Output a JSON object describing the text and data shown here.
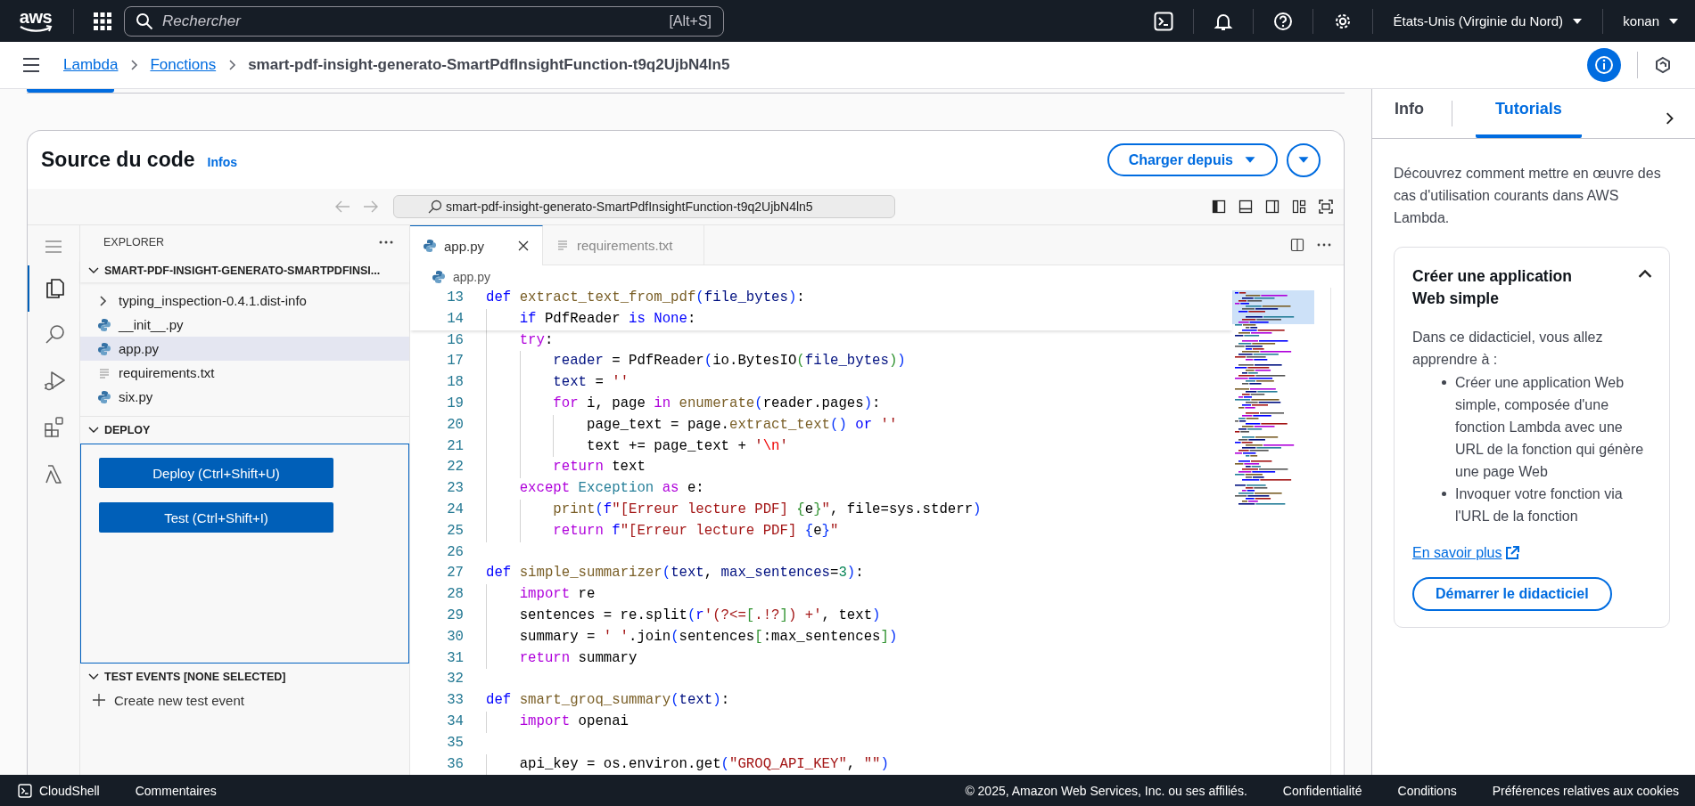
{
  "top_bar": {
    "logo": "aws",
    "search": {
      "placeholder": "Rechercher",
      "shortcut": "[Alt+S]"
    },
    "region": "États-Unis (Virginie du Nord)",
    "user": "konan"
  },
  "breadcrumb": [
    {
      "label": "Lambda",
      "kind": "link"
    },
    {
      "label": "Fonctions",
      "kind": "link"
    },
    {
      "label": "smart-pdf-insight-generato-SmartPdfInsightFunction-t9q2UjbN4ln5",
      "kind": "current"
    }
  ],
  "code_source": {
    "title": "Source du code",
    "info_link": "Infos",
    "load_button": "Charger depuis"
  },
  "ide": {
    "address": "smart-pdf-insight-generato-SmartPdfInsightFunction-t9q2UjbN4ln5",
    "activity_bar": [
      {
        "kind": "explorer",
        "selected": true
      },
      {
        "kind": "search",
        "selected": false
      },
      {
        "kind": "debug",
        "selected": false
      },
      {
        "kind": "extensions",
        "selected": false
      },
      {
        "kind": "lambda",
        "selected": false
      }
    ],
    "explorer": {
      "title": "EXPLORER",
      "sections": [
        {
          "kind": "files",
          "title": "SMART-PDF-INSIGHT-GENERATO-SMARTPDFINSI...",
          "expanded": true,
          "items": [
            {
              "kind": "folder",
              "label": "typing_inspection-0.4.1.dist-info",
              "expanded": false,
              "selected": false
            },
            {
              "kind": "python",
              "label": "__init__.py",
              "selected": false
            },
            {
              "kind": "python",
              "label": "app.py",
              "selected": true
            },
            {
              "kind": "text",
              "label": "requirements.txt",
              "selected": false
            },
            {
              "kind": "python",
              "label": "six.py",
              "selected": false
            }
          ]
        },
        {
          "kind": "deploy",
          "title": "DEPLOY",
          "expanded": true,
          "buttons": [
            "Deploy (Ctrl+Shift+U)",
            "Test (Ctrl+Shift+I)"
          ]
        },
        {
          "kind": "test_events",
          "title": "TEST EVENTS [NONE SELECTED]",
          "expanded": true,
          "action": "Create new test event"
        }
      ]
    },
    "tabs": [
      {
        "label": "app.py",
        "kind": "python",
        "selected": true
      },
      {
        "label": "requirements.txt",
        "kind": "text",
        "selected": false
      }
    ],
    "file_breadcrumb": "app.py",
    "code": {
      "sticky": [
        {
          "number": "13",
          "tokens": [
            {
              "kind": "kw",
              "text": "def"
            },
            {
              "kind": "fn",
              "text": " extract_text_from_pdf"
            },
            {
              "kind": "b1",
              "text": "("
            },
            {
              "kind": "var",
              "text": "file_bytes"
            },
            {
              "kind": "b1",
              "text": ")"
            },
            {
              "kind": "p",
              "text": ":"
            }
          ]
        },
        {
          "number": "14",
          "tokens": [
            {
              "kind": "kw",
              "text": "    if"
            },
            {
              "kind": "p",
              "text": " PdfReader "
            },
            {
              "kind": "kw",
              "text": "is"
            },
            {
              "kind": "kw",
              "text": " None"
            },
            {
              "kind": "p",
              "text": ":"
            }
          ]
        }
      ],
      "lines": [
        {
          "number": "16",
          "tokens": [
            {
              "kind": "ctrl",
              "text": "    try"
            },
            {
              "kind": "p",
              "text": ":"
            }
          ]
        },
        {
          "number": "17",
          "tokens": [
            {
              "kind": "var",
              "text": "        reader"
            },
            {
              "kind": "p",
              "text": " = PdfReader"
            },
            {
              "kind": "b1",
              "text": "("
            },
            {
              "kind": "p",
              "text": "io.BytesIO"
            },
            {
              "kind": "b2",
              "text": "("
            },
            {
              "kind": "var",
              "text": "file_bytes"
            },
            {
              "kind": "b2",
              "text": ")"
            },
            {
              "kind": "b1",
              "text": ")"
            }
          ]
        },
        {
          "number": "18",
          "tokens": [
            {
              "kind": "var",
              "text": "        text"
            },
            {
              "kind": "p",
              "text": " = "
            },
            {
              "kind": "str",
              "text": "''"
            }
          ]
        },
        {
          "number": "19",
          "tokens": [
            {
              "kind": "ctrl",
              "text": "        for"
            },
            {
              "kind": "p",
              "text": " i, page "
            },
            {
              "kind": "ctrl",
              "text": "in"
            },
            {
              "kind": "fn",
              "text": " enumerate"
            },
            {
              "kind": "b1",
              "text": "("
            },
            {
              "kind": "p",
              "text": "reader.pages"
            },
            {
              "kind": "b1",
              "text": ")"
            },
            {
              "kind": "p",
              "text": ":"
            }
          ]
        },
        {
          "number": "20",
          "tokens": [
            {
              "kind": "p",
              "text": "            page_text = page."
            },
            {
              "kind": "fn",
              "text": "extract_text"
            },
            {
              "kind": "b1",
              "text": "()"
            },
            {
              "kind": "kw",
              "text": " or"
            },
            {
              "kind": "str",
              "text": " ''"
            }
          ]
        },
        {
          "number": "21",
          "tokens": [
            {
              "kind": "p",
              "text": "            text += page_text + "
            },
            {
              "kind": "str",
              "text": "'"
            },
            {
              "kind": "esc",
              "text": "\\n"
            },
            {
              "kind": "str",
              "text": "'"
            }
          ]
        },
        {
          "number": "22",
          "tokens": [
            {
              "kind": "ctrl",
              "text": "        return"
            },
            {
              "kind": "p",
              "text": " text"
            }
          ]
        },
        {
          "number": "23",
          "tokens": [
            {
              "kind": "ctrl",
              "text": "    except"
            },
            {
              "kind": "cls",
              "text": " Exception"
            },
            {
              "kind": "ctrl",
              "text": " as"
            },
            {
              "kind": "p",
              "text": " e:"
            }
          ]
        },
        {
          "number": "24",
          "tokens": [
            {
              "kind": "fn",
              "text": "        print"
            },
            {
              "kind": "b1",
              "text": "("
            },
            {
              "kind": "kw",
              "text": "f"
            },
            {
              "kind": "str",
              "text": "\"[Erreur lecture PDF] "
            },
            {
              "kind": "b2",
              "text": "{"
            },
            {
              "kind": "p",
              "text": "e"
            },
            {
              "kind": "b2",
              "text": "}"
            },
            {
              "kind": "str",
              "text": "\""
            },
            {
              "kind": "p",
              "text": ", file=sys.stderr"
            },
            {
              "kind": "b1",
              "text": ")"
            }
          ]
        },
        {
          "number": "25",
          "tokens": [
            {
              "kind": "ctrl",
              "text": "        return"
            },
            {
              "kind": "kw",
              "text": " f"
            },
            {
              "kind": "str",
              "text": "\"[Erreur lecture PDF] "
            },
            {
              "kind": "b1",
              "text": "{"
            },
            {
              "kind": "p",
              "text": "e"
            },
            {
              "kind": "b1",
              "text": "}"
            },
            {
              "kind": "str",
              "text": "\""
            }
          ]
        },
        {
          "number": "26"
        },
        {
          "number": "27",
          "tokens": [
            {
              "kind": "kw",
              "text": "def"
            },
            {
              "kind": "fn",
              "text": " simple_summarizer"
            },
            {
              "kind": "b1",
              "text": "("
            },
            {
              "kind": "var",
              "text": "text"
            },
            {
              "kind": "p",
              "text": ", "
            },
            {
              "kind": "var",
              "text": "max_sentences"
            },
            {
              "kind": "p",
              "text": "="
            },
            {
              "kind": "num",
              "text": "3"
            },
            {
              "kind": "b1",
              "text": ")"
            },
            {
              "kind": "p",
              "text": ":"
            }
          ]
        },
        {
          "number": "28",
          "tokens": [
            {
              "kind": "ctrl",
              "text": "    import"
            },
            {
              "kind": "p",
              "text": " re"
            }
          ]
        },
        {
          "number": "29",
          "tokens": [
            {
              "kind": "p",
              "text": "    sentences = re.split"
            },
            {
              "kind": "b1",
              "text": "("
            },
            {
              "kind": "kw",
              "text": "r"
            },
            {
              "kind": "str",
              "text": "'(?<="
            },
            {
              "kind": "b2",
              "text": "["
            },
            {
              "kind": "str",
              "text": ".!?"
            },
            {
              "kind": "b2",
              "text": "]"
            },
            {
              "kind": "str",
              "text": ") +'"
            },
            {
              "kind": "p",
              "text": ", text"
            },
            {
              "kind": "b1",
              "text": ")"
            }
          ]
        },
        {
          "number": "30",
          "tokens": [
            {
              "kind": "p",
              "text": "    summary = "
            },
            {
              "kind": "str",
              "text": "' '"
            },
            {
              "kind": "p",
              "text": ".join"
            },
            {
              "kind": "b1",
              "text": "("
            },
            {
              "kind": "p",
              "text": "sentences"
            },
            {
              "kind": "b2",
              "text": "["
            },
            {
              "kind": "p",
              "text": ":max_sentences"
            },
            {
              "kind": "b2",
              "text": "]"
            },
            {
              "kind": "b1",
              "text": ")"
            }
          ]
        },
        {
          "number": "31",
          "tokens": [
            {
              "kind": "ctrl",
              "text": "    return"
            },
            {
              "kind": "p",
              "text": " summary"
            }
          ]
        },
        {
          "number": "32"
        },
        {
          "number": "33",
          "tokens": [
            {
              "kind": "kw",
              "text": "def"
            },
            {
              "kind": "fn",
              "text": " smart_groq_summary"
            },
            {
              "kind": "b1",
              "text": "("
            },
            {
              "kind": "var",
              "text": "text"
            },
            {
              "kind": "b1",
              "text": ")"
            },
            {
              "kind": "p",
              "text": ":"
            }
          ]
        },
        {
          "number": "34",
          "tokens": [
            {
              "kind": "ctrl",
              "text": "    import"
            },
            {
              "kind": "p",
              "text": " openai"
            }
          ]
        },
        {
          "number": "35"
        },
        {
          "number": "36",
          "tokens": [
            {
              "kind": "p",
              "text": "    api_key = os.environ.get"
            },
            {
              "kind": "b1",
              "text": "("
            },
            {
              "kind": "str",
              "text": "\"GROQ_API_KEY\""
            },
            {
              "kind": "p",
              "text": ", "
            },
            {
              "kind": "str",
              "text": "\"\""
            },
            {
              "kind": "b1",
              "text": ")"
            }
          ]
        }
      ]
    }
  },
  "side_panel": {
    "tabs": [
      {
        "label": "Info",
        "selected": false
      },
      {
        "label": "Tutorials",
        "selected": true
      }
    ],
    "intro": "Découvrez comment mettre en œuvre des cas d'utilisation courants dans AWS Lambda.",
    "tutorial": {
      "title": "Créer une application Web simple",
      "expanded": true,
      "lead": "Dans ce didacticiel, vous allez apprendre à :",
      "bullets": [
        "Créer une application Web simple, composée d'une fonction Lambda avec une URL de la fonction qui génère une page Web",
        "Invoquer votre fonction via l'URL de la fonction"
      ],
      "link": "En savoir plus",
      "button": "Démarrer le didacticiel"
    }
  },
  "footer": {
    "cloudshell": "CloudShell",
    "feedback": "Commentaires",
    "copyright": "© 2025, Amazon Web Services, Inc. ou ses affiliés.",
    "links": [
      "Confidentialité",
      "Conditions",
      "Préférences relatives aux cookies"
    ]
  }
}
